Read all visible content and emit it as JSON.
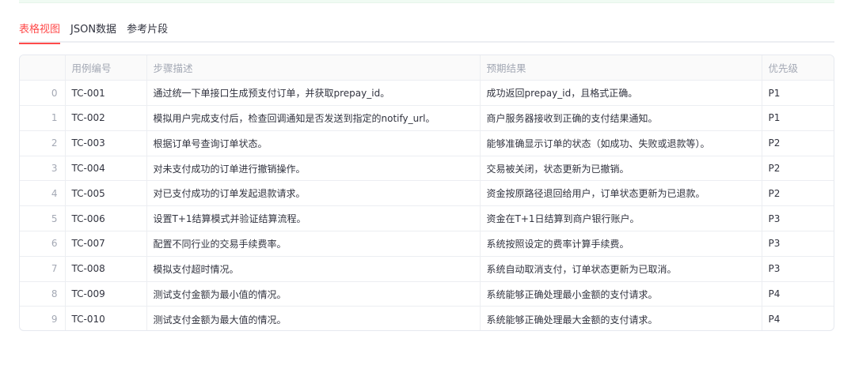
{
  "tabs": [
    {
      "label": "表格视图",
      "active": true
    },
    {
      "label": "JSON数据",
      "active": false
    },
    {
      "label": "参考片段",
      "active": false
    }
  ],
  "accent_color": "#ff4b4b",
  "table": {
    "columns": [
      "",
      "用例编号",
      "步骤描述",
      "预期结果",
      "优先级"
    ],
    "rows": [
      [
        "0",
        "TC-001",
        "通过统一下单接口生成预支付订单，并获取prepay_id。",
        "成功返回prepay_id，且格式正确。",
        "P1"
      ],
      [
        "1",
        "TC-002",
        "模拟用户完成支付后，检查回调通知是否发送到指定的notify_url。",
        "商户服务器接收到正确的支付结果通知。",
        "P1"
      ],
      [
        "2",
        "TC-003",
        "根据订单号查询订单状态。",
        "能够准确显示订单的状态（如成功、失败或退款等）。",
        "P2"
      ],
      [
        "3",
        "TC-004",
        "对未支付成功的订单进行撤销操作。",
        "交易被关闭，状态更新为已撤销。",
        "P2"
      ],
      [
        "4",
        "TC-005",
        "对已支付成功的订单发起退款请求。",
        "资金按原路径退回给用户，订单状态更新为已退款。",
        "P2"
      ],
      [
        "5",
        "TC-006",
        "设置T+1结算模式并验证结算流程。",
        "资金在T+1日结算到商户银行账户。",
        "P3"
      ],
      [
        "6",
        "TC-007",
        "配置不同行业的交易手续费率。",
        "系统按照设定的费率计算手续费。",
        "P3"
      ],
      [
        "7",
        "TC-008",
        "模拟支付超时情况。",
        "系统自动取消支付，订单状态更新为已取消。",
        "P3"
      ],
      [
        "8",
        "TC-009",
        "测试支付金额为最小值的情况。",
        "系统能够正确处理最小金额的支付请求。",
        "P4"
      ],
      [
        "9",
        "TC-010",
        "测试支付金额为最大值的情况。",
        "系统能够正确处理最大金额的支付请求。",
        "P4"
      ]
    ]
  }
}
